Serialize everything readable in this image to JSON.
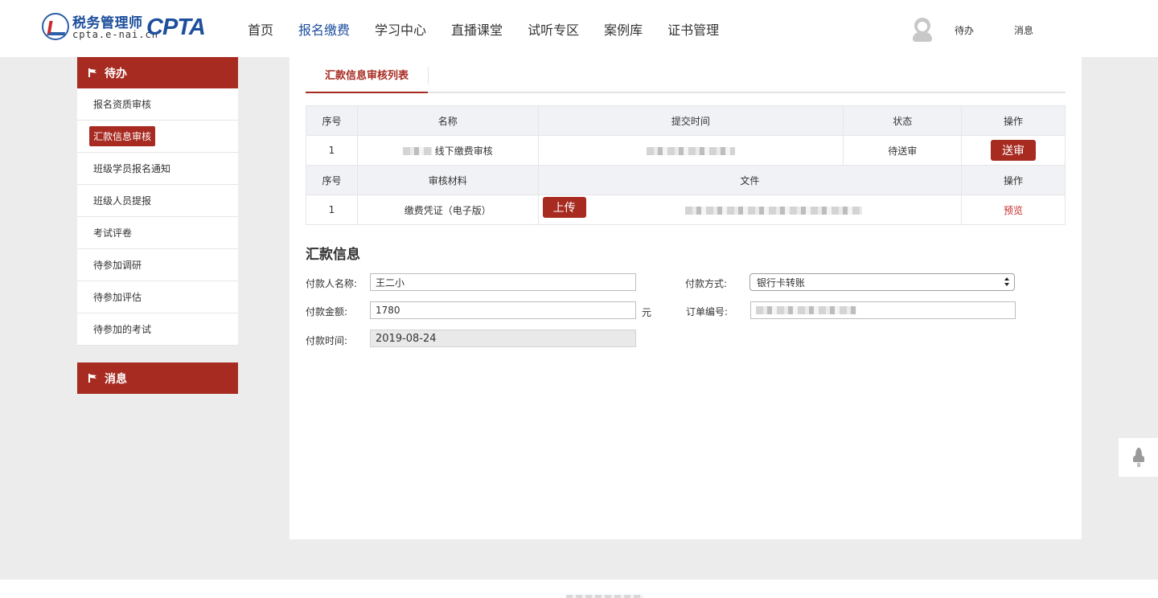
{
  "logo": {
    "cn": "税务管理师",
    "en": "cpta.e-nai.cn",
    "brand": "CPTA"
  },
  "nav": [
    "首页",
    "报名缴费",
    "学习中心",
    "直播课堂",
    "试听专区",
    "案例库",
    "证书管理"
  ],
  "header_links": {
    "todo": "待办",
    "messages": "消息"
  },
  "sidebar": {
    "todo_title": "待办",
    "items": [
      "报名资质审核",
      "汇款信息审核",
      "班级学员报名通知",
      "班级人员提报",
      "考试评卷",
      "待参加调研",
      "待参加评估",
      "待参加的考试"
    ],
    "msg_title": "消息"
  },
  "tab": "汇款信息审核列表",
  "table1": {
    "headers": [
      "序号",
      "名称",
      "提交时间",
      "状态",
      "操作"
    ],
    "row": {
      "index": "1",
      "name_suffix": "线下缴费审核",
      "status": "待送审",
      "action": "送审"
    }
  },
  "table2": {
    "headers": [
      "序号",
      "审核材料",
      "文件",
      "操作"
    ],
    "row": {
      "index": "1",
      "material": "缴费凭证（电子版）",
      "upload": "上传",
      "action": "预览"
    }
  },
  "remit": {
    "title": "汇款信息",
    "payer_label": "付款人名称:",
    "payer_value": "王二小",
    "method_label": "付款方式:",
    "method_value": "银行卡转账",
    "amount_label": "付款金额:",
    "amount_value": "1780",
    "amount_unit": "元",
    "order_label": "订单编号:",
    "time_label": "付款时间:",
    "time_value": "2019-08-24"
  },
  "colors": {
    "primary_red": "#a72b21",
    "nav_active": "#1e4f9c"
  }
}
